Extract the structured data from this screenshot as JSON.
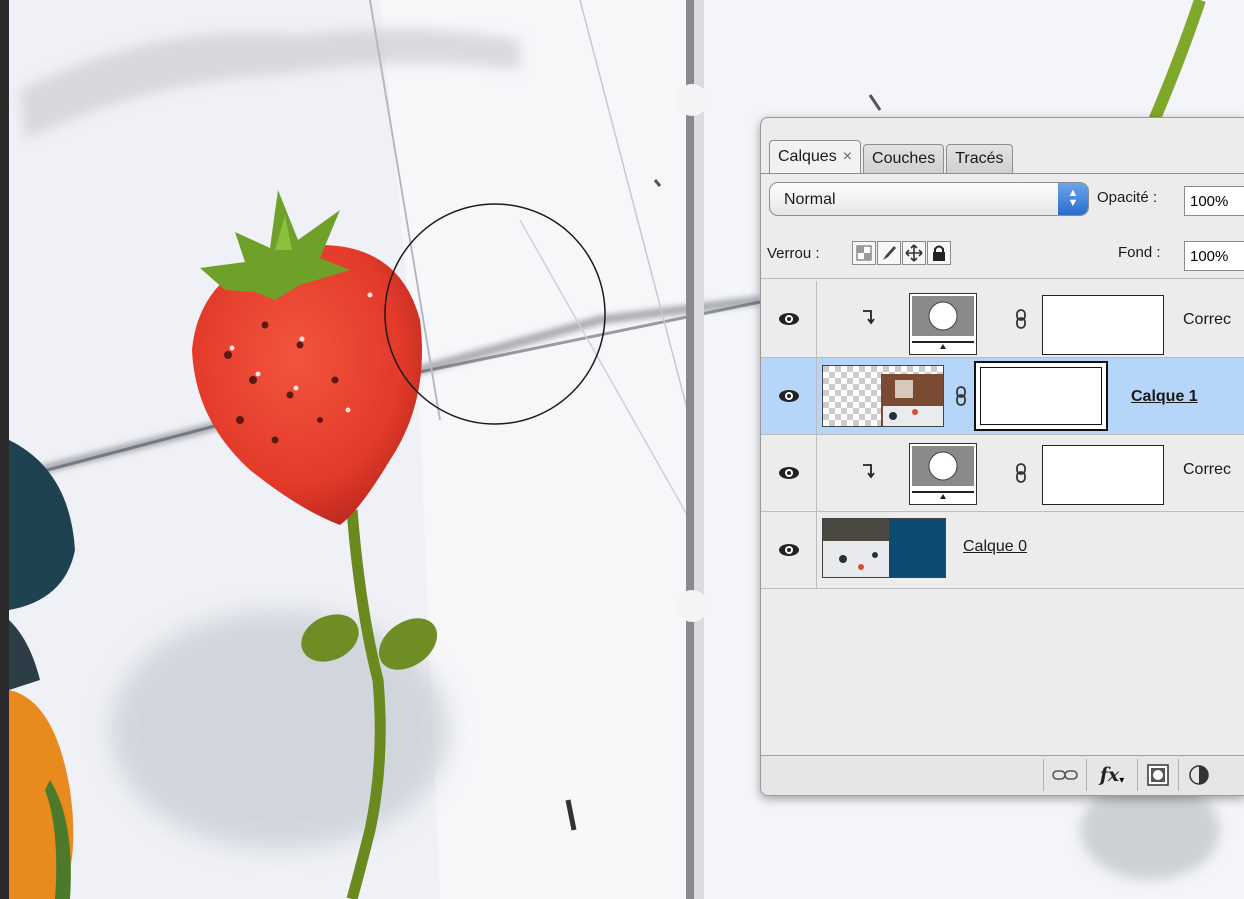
{
  "panel": {
    "tabs": [
      {
        "label": "Calques",
        "close": "×"
      },
      {
        "label": "Couches"
      },
      {
        "label": "Tracés"
      }
    ],
    "blend_mode": "Normal",
    "opacity_label": "Opacité :",
    "opacity_value": "100%",
    "lock_label": "Verrou :",
    "lock_icons": [
      "lock-transparency-icon",
      "lock-image-icon",
      "lock-position-icon",
      "lock-all-icon"
    ],
    "fill_label": "Fond :",
    "fill_value": "100%",
    "layers": [
      {
        "name": "Correc",
        "type": "adjustment",
        "clipped": true,
        "visible": true
      },
      {
        "name": "Calque 1",
        "type": "pixel",
        "masked": true,
        "selected": true,
        "visible": true
      },
      {
        "name": "Correc",
        "type": "adjustment",
        "clipped": true,
        "visible": true
      },
      {
        "name": "Calque 0",
        "type": "pixel",
        "visible": true
      }
    ],
    "footer_icons": [
      "link-layers-icon",
      "fx-icon",
      "add-mask-icon",
      "adjustment-icon"
    ],
    "footer_fx_label": "fx"
  },
  "colors": {
    "selected_row": "#b5d5f9",
    "select_arrow": "#2a6ccf",
    "strawberry": "#e8412f",
    "stem": "#6a8a1f",
    "calque0_blue": "#0d4a72"
  }
}
